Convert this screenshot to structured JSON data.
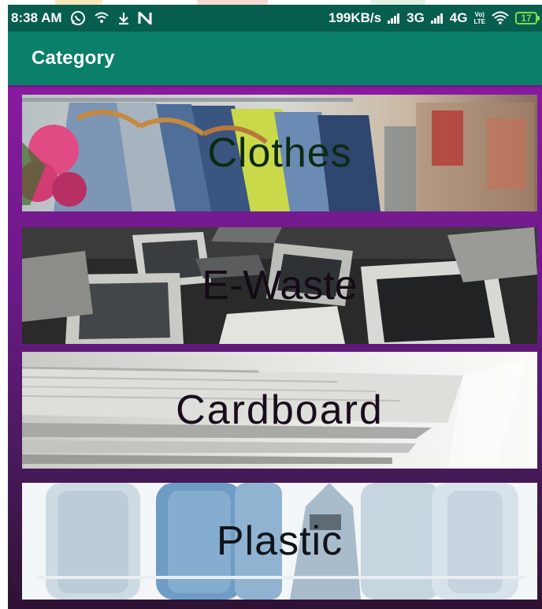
{
  "status_bar": {
    "time": "8:38 AM",
    "network_speed": "199KB/s",
    "network_3g": "3G",
    "network_4g": "4G",
    "volte_top": "Vo)",
    "volte_bottom": "LTE",
    "battery": "17",
    "icons": [
      "whatsapp-icon",
      "wifi-hotspot-icon",
      "download-icon",
      "n-notification-icon",
      "signal-icon",
      "wifi-icon",
      "battery-icon"
    ]
  },
  "app_bar": {
    "title": "Category"
  },
  "categories": [
    {
      "label": "Clothes",
      "image": "clothes-photo"
    },
    {
      "label": "E-Waste",
      "image": "ewaste-photo"
    },
    {
      "label": "Cardboard",
      "image": "cardboard-photo"
    },
    {
      "label": "Plastic",
      "image": "plastic-photo"
    }
  ],
  "colors": {
    "status_bar": "#075e4e",
    "app_bar": "#0a7f6a",
    "background_top": "#8a1aa0",
    "background_bottom": "#2e1233",
    "battery": "#7fdc4a"
  }
}
